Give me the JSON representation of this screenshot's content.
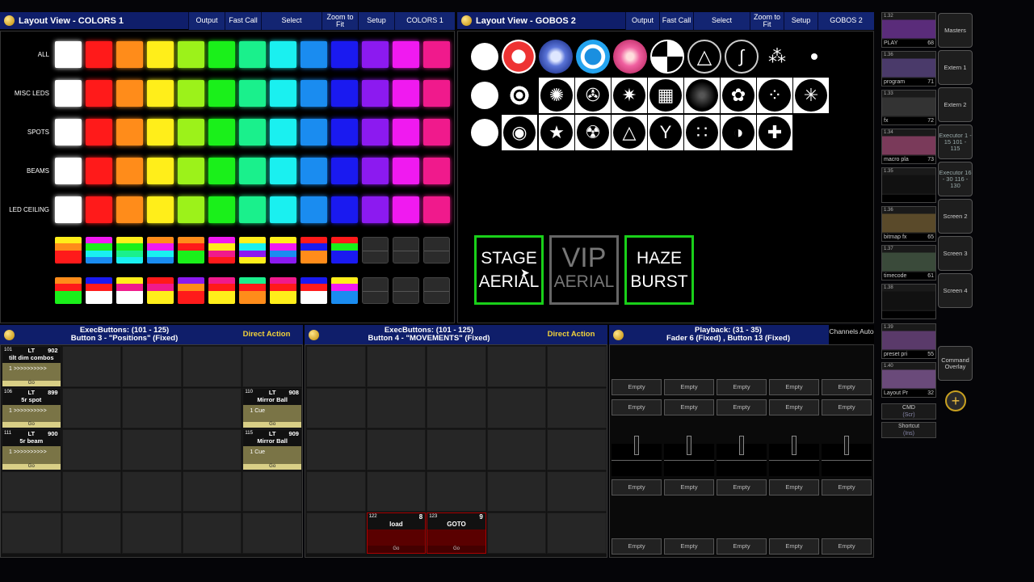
{
  "colors_view": {
    "title": "Layout View - COLORS 1",
    "buttons": [
      "Output",
      "Fast Call",
      "Select",
      "Zoom to Fit",
      "Setup",
      "COLORS 1"
    ],
    "row_labels": [
      "ALL",
      "MISC LEDS",
      "SPOTS",
      "BEAMS",
      "LED CEILING"
    ],
    "palette": [
      "#ffffff",
      "#ff1a1a",
      "#ff8c1a",
      "#ffee1a",
      "#9cf21a",
      "#1af01a",
      "#1af08c",
      "#1af0f0",
      "#1a8cf0",
      "#1a1af0",
      "#8c1af0",
      "#f01af0",
      "#f01a8c"
    ]
  },
  "gobos_view": {
    "title": "Layout View - GOBOS 2",
    "buttons": [
      "Output",
      "Fast Call",
      "Select",
      "Zoom to Fit",
      "Setup",
      "GOBOS 2"
    ]
  },
  "stage_buttons": [
    {
      "line1": "STAGE",
      "line2": "AERIAL",
      "dim": false
    },
    {
      "line1": "VIP",
      "line2": "AERIAL",
      "dim": true
    },
    {
      "line1": "HAZE",
      "line2": "BURST",
      "dim": false
    }
  ],
  "exec1": {
    "line1": "ExecButtons: (101 - 125)",
    "line2": "Button  3  - \"Positions\" (Fixed)",
    "mode": "Direct Action",
    "active": [
      {
        "num": "101",
        "type": "LT",
        "id": "902",
        "name": "tilt dim combos",
        "body": "1 >>>>>>>>>>",
        "go": "Go"
      },
      {
        "num": "106",
        "type": "LT",
        "id": "899",
        "name": "5r spot",
        "body": "1 >>>>>>>>>>",
        "go": "Go"
      },
      {
        "num": "110",
        "type": "LT",
        "id": "908",
        "name": "Mirror Ball",
        "body": "1 Cue",
        "go": "Go"
      },
      {
        "num": "111",
        "type": "LT",
        "id": "900",
        "name": "5r beam",
        "body": "1 >>>>>>>>>>",
        "go": "Go"
      },
      {
        "num": "115",
        "type": "LT",
        "id": "909",
        "name": "Mirror Ball",
        "body": "1 Cue",
        "go": "Go"
      }
    ]
  },
  "exec2": {
    "line1": "ExecButtons: (101 - 125)",
    "line2": "Button  4  - \"MOVEMENTS\" (Fixed)",
    "mode": "Direct Action",
    "active": [
      {
        "num": "122",
        "id": "8",
        "name": "load",
        "go": "Go"
      },
      {
        "num": "123",
        "id": "9",
        "name": "GOTO",
        "go": "Go"
      }
    ]
  },
  "playback": {
    "line1": "Playback: (31 - 35)",
    "line2": "Fader  6 (Fixed) , Button  13 (Fixed)",
    "mode": "Channels Auto",
    "empty_label": "Empty"
  },
  "sidebar": {
    "views": [
      {
        "num": "1.32",
        "label": "PLAY",
        "val": "68"
      },
      {
        "num": "1.36",
        "label": "program",
        "val": "71"
      },
      {
        "num": "1.33",
        "label": "fx",
        "val": "72"
      },
      {
        "num": "1.34",
        "label": "macro pla",
        "val": "73"
      },
      {
        "num": "1.35",
        "label": "",
        "val": ""
      },
      {
        "num": "1.36",
        "label": "bitmap fx",
        "val": "65"
      },
      {
        "num": "1.37",
        "label": "timecode",
        "val": "61"
      },
      {
        "num": "1.38",
        "label": "",
        "val": ""
      },
      {
        "num": "1.39",
        "label": "preset pri",
        "val": "55"
      },
      {
        "num": "1.40",
        "label": "Layout Pr",
        "val": "32"
      }
    ],
    "cmd": "CMD",
    "cmd_sub": "(Scr)",
    "shortcut": "Shortcut",
    "shortcut_sub": "(Ins)",
    "right": [
      "Masters",
      "Extern 1",
      "Extern 2",
      "Executor 1 - 15 101 - 115",
      "Executor 16 - 30 116 - 130",
      "Screen 2",
      "Screen 3",
      "Screen 4",
      "Command Overlay"
    ]
  }
}
